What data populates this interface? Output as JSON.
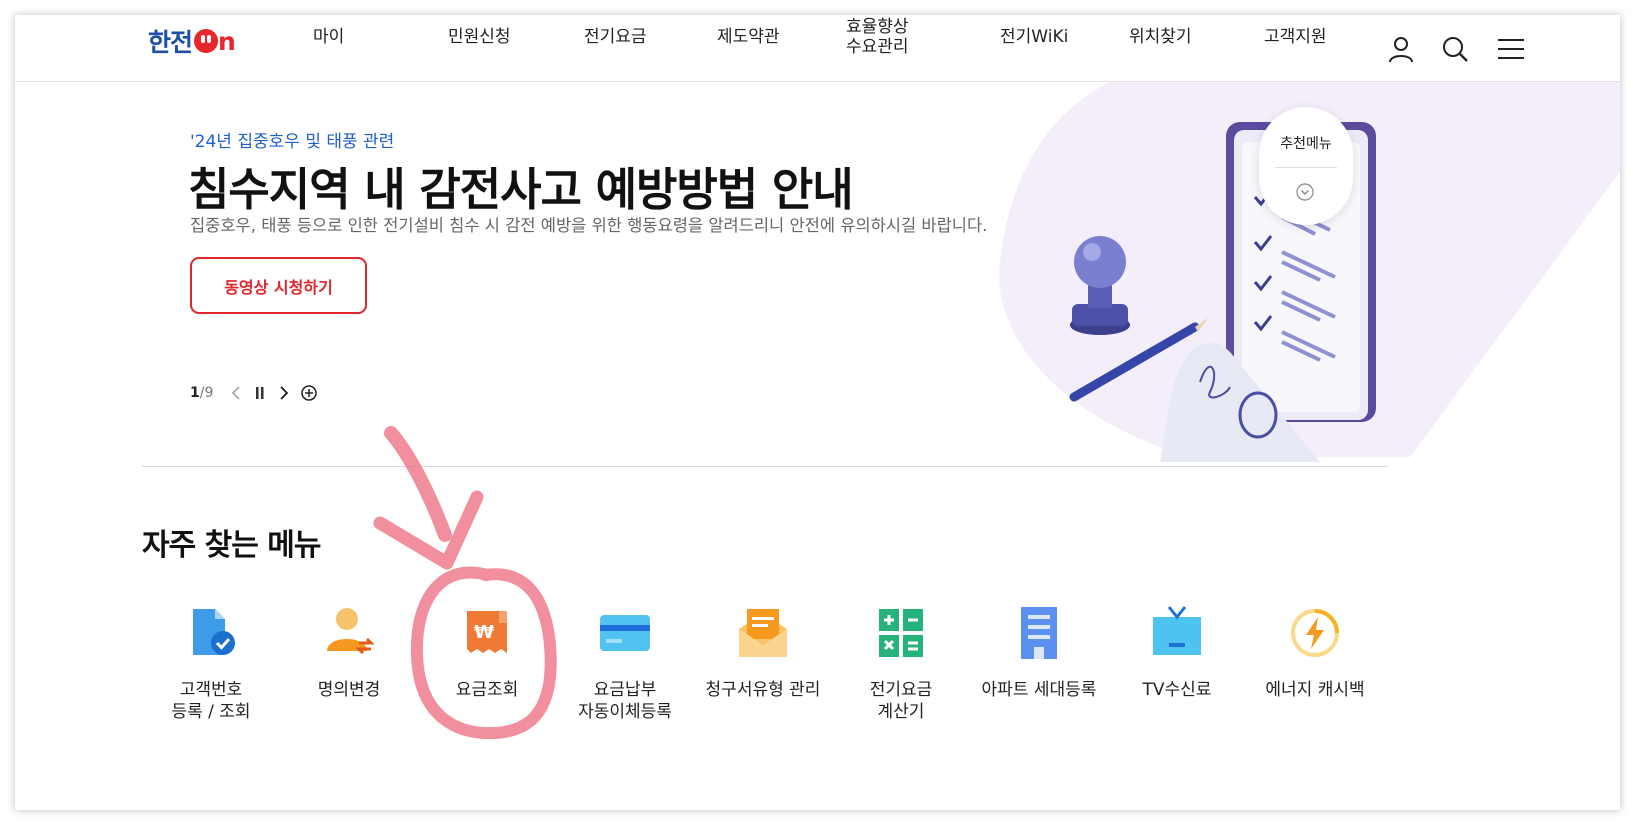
{
  "header": {
    "logo_text": "한전",
    "logo_on": "n",
    "nav": [
      "마이",
      "민원신청",
      "전기요금",
      "제도약관",
      "효율향상\n수요관리",
      "전기WiKi",
      "위치찾기",
      "고객지원"
    ],
    "icons": [
      "user-icon",
      "search-icon",
      "hamburger-menu-icon"
    ]
  },
  "hero": {
    "subtitle": "'24년 집중호우 및 태풍 관련",
    "title": "침수지역 내 감전사고 예방방법 안내",
    "description": "집중호우, 태풍 등으로 인한 전기설비 침수 시 감전 예방을 위한 행동요령을 알려드리니 안전에 유의하시길 바랍니다.",
    "button": "동영상 시청하기",
    "pager": {
      "current": "1",
      "total": "/9"
    },
    "colors": {
      "accent_blue": "#1f5fd0",
      "accent_red": "#e0262b"
    }
  },
  "recommend": {
    "label": "추천메뉴"
  },
  "frequent": {
    "title": "자주 찾는 메뉴",
    "items": [
      {
        "label1": "고객번호",
        "label2": "등록 / 조회",
        "icon": "document-check-icon"
      },
      {
        "label1": "명의변경",
        "label2": "",
        "icon": "user-change-icon"
      },
      {
        "label1": "요금조회",
        "label2": "",
        "icon": "won-receipt-icon"
      },
      {
        "label1": "요금납부",
        "label2": "자동이체등록",
        "icon": "credit-card-icon"
      },
      {
        "label1": "청구서유형 관리",
        "label2": "",
        "icon": "mail-icon"
      },
      {
        "label1": "전기요금",
        "label2": "계산기",
        "icon": "calculator-icon"
      },
      {
        "label1": "아파트 세대등록",
        "label2": "",
        "icon": "apartment-icon"
      },
      {
        "label1": "TV수신료",
        "label2": "",
        "icon": "tv-icon"
      },
      {
        "label1": "에너지 캐시백",
        "label2": "",
        "icon": "energy-cashback-icon"
      }
    ]
  }
}
